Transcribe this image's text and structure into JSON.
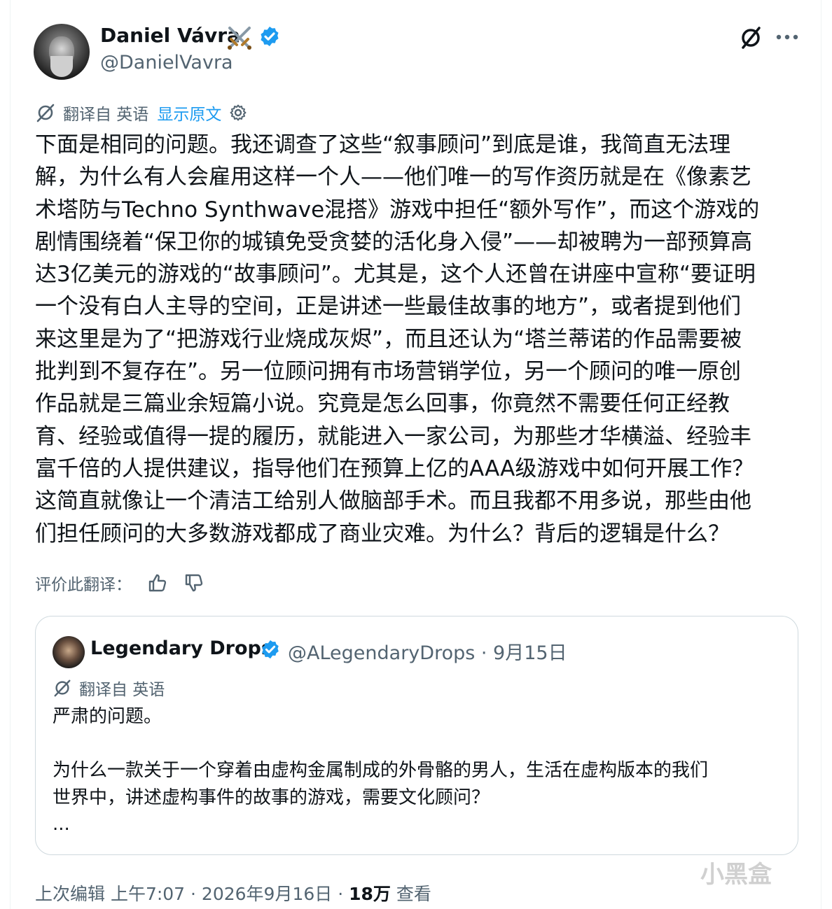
{
  "tweet": {
    "author_name": "Daniel Vávra",
    "handle": "@DanielVavra",
    "translation": {
      "label": "翻译自 英语",
      "show_original": "显示原文"
    },
    "text": "下面是相同的问题。我还调查了这些“叙事顾问”到底是谁，我简直无法理\n解，为什么有人会雇用这样一个人——他们唯一的写作资历就是在《像素艺\n术塔防与Techno Synthwave混搭》游戏中担任“额外写作”，而这个游戏的\n剧情围绕着“保卫你的城镇免受贪婪的活化身入侵”——却被聘为一部预算高\n达3亿美元的游戏的“故事顾问”。尤其是，这个人还曾在讲座中宣称“要证明\n一个没有白人主导的空间，正是讲述一些最佳故事的地方”，或者提到他们\n来这里是为了“把游戏行业烧成灰烬”，而且还认为“塔兰蒂诺的作品需要被\n批判到不复存在”。另一位顾问拥有市场营销学位，另一个顾问的唯一原创\n作品就是三篇业余短篇小说。究竟是怎么回事，你竟然不需要任何正经教\n育、经验或值得一提的履历，就能进入一家公司，为那些才华横溢、经验丰\n富千倍的人提供建议，指导他们在预算上亿的AAA级游戏中如何开展工作？\n这简直就像让一个清洁工给别人做脑部手术。而且我都不用多说，那些由他\n们担任顾问的大多数游戏都成了商业灾难。为什么？背后的逻辑是什么？",
    "rate_label": "评价此翻译："
  },
  "quoted_tweet": {
    "author_name": "Legendary Drops",
    "meta": "@ALegendaryDrops · 9月15日",
    "translation_label": "翻译自 英语",
    "text": "严肃的问题。\n\n为什么一款关于一个穿着由虚构金属制成的外骨骼的男人，生活在虚构版本的我们\n世界中，讲述虚构事件的故事的游戏，需要文化顾问？\n..."
  },
  "footer": {
    "prefix": "上次编辑 上午7:07 · 2026年9月16日 · ",
    "views_count": "18万",
    "views_label": " 查看"
  },
  "watermark": "小黑盒",
  "colors": {
    "verified_blue": "#1d9bf0",
    "secondary_text": "#536471",
    "primary_text": "#0f1419",
    "border": "#cfd9de"
  },
  "icons": [
    "swords-icon",
    "verified-badge-icon",
    "grok-icon",
    "more-options-icon",
    "translate-icon",
    "gear-icon",
    "thumbs-up-icon",
    "thumbs-down-icon"
  ]
}
